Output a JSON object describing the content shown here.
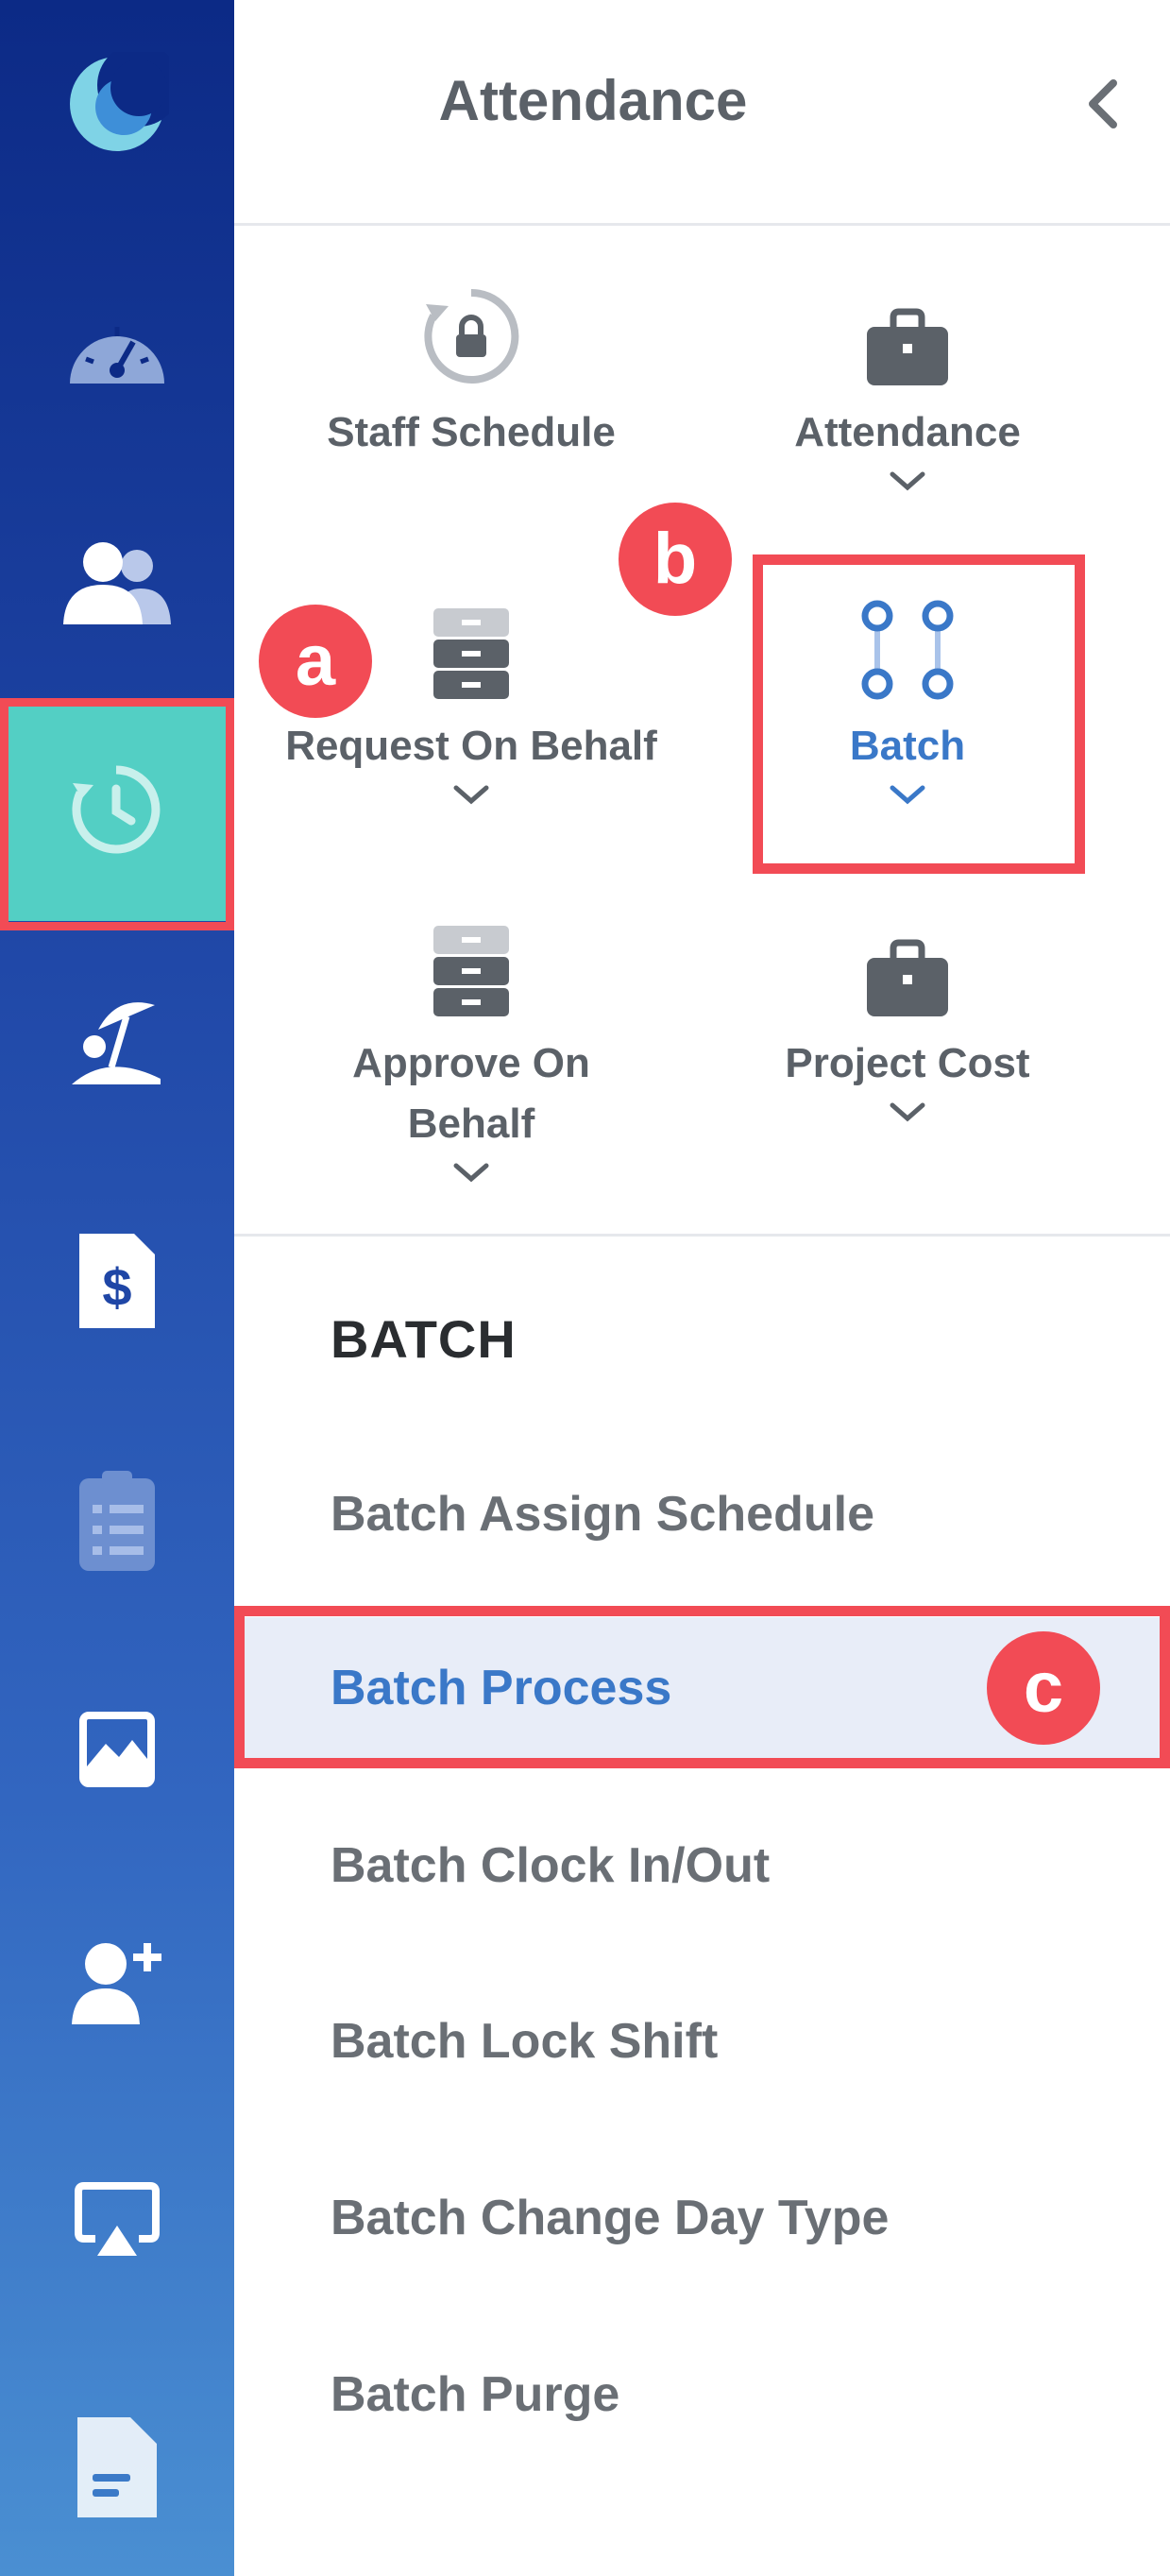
{
  "panel": {
    "title": "Attendance"
  },
  "tiles": [
    {
      "label": "Staff Schedule",
      "icon": "clock-lock-icon",
      "has_chevron": false
    },
    {
      "label": "Attendance",
      "icon": "briefcase-icon",
      "has_chevron": true
    },
    {
      "label": "Request On Behalf",
      "icon": "cabinet-icon",
      "has_chevron": true
    },
    {
      "label": "Batch",
      "icon": "batch-nodes-icon",
      "has_chevron": true,
      "active": true
    },
    {
      "label": "Approve On Behalf",
      "icon": "cabinet-icon",
      "has_chevron": true
    },
    {
      "label": "Project Cost",
      "icon": "briefcase-icon",
      "has_chevron": true
    }
  ],
  "section": {
    "title": "BATCH"
  },
  "menu": [
    {
      "label": "Batch Assign Schedule"
    },
    {
      "label": "Batch Process",
      "active": true
    },
    {
      "label": "Batch Clock In/Out"
    },
    {
      "label": "Batch Lock Shift"
    },
    {
      "label": "Batch Change Day Type"
    },
    {
      "label": "Batch Purge"
    }
  ],
  "badges": {
    "a": "a",
    "b": "b",
    "c": "c"
  },
  "sidebar": {
    "icons": [
      "moon-logo-icon",
      "dashboard-gauge-icon",
      "people-icon",
      "attendance-clock-icon",
      "beach-umbrella-icon",
      "payroll-dollar-icon",
      "clipboard-list-icon",
      "chart-image-icon",
      "add-user-icon",
      "screen-cast-icon",
      "document-icon"
    ]
  },
  "colors": {
    "accent": "#3a78c8",
    "highlight": "#f24b55",
    "active_rail": "#53cfc4"
  }
}
